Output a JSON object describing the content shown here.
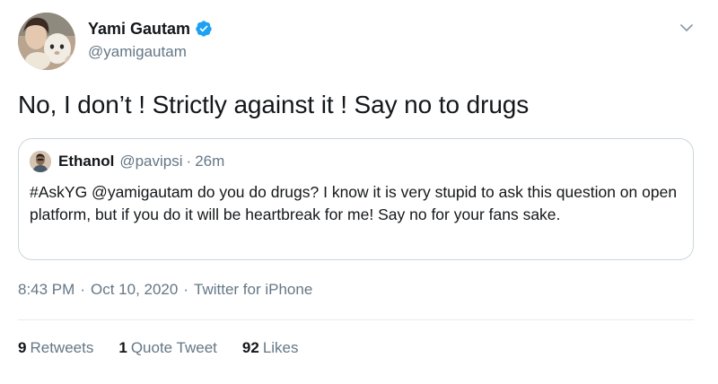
{
  "author": {
    "display_name": "Yami Gautam",
    "handle": "@yamigautam",
    "verified": true,
    "avatar_icon": "profile-photo-avatar"
  },
  "tweet": {
    "text": "No, I don’t ! Strictly against it ! Say no to drugs"
  },
  "quoted_tweet": {
    "name": "Ethanol",
    "handle": "@pavipsi",
    "separator": "·",
    "time": "26m",
    "text": "#AskYG @yamigautam do you do drugs? I know it is very stupid to ask this question on open platform, but if you do it will be heartbreak for me! Say no for your fans sake."
  },
  "meta": {
    "time": "8:43 PM",
    "separator": "·",
    "date": "Oct 10, 2020",
    "source": "Twitter for iPhone"
  },
  "stats": {
    "retweets_count": "9",
    "retweets_label": "Retweets",
    "quotes_count": "1",
    "quotes_label": "Quote Tweet",
    "likes_count": "92",
    "likes_label": "Likes"
  },
  "colors": {
    "verified_blue": "#1da1f2",
    "secondary_text": "#657786",
    "border": "#ccd6dd"
  }
}
